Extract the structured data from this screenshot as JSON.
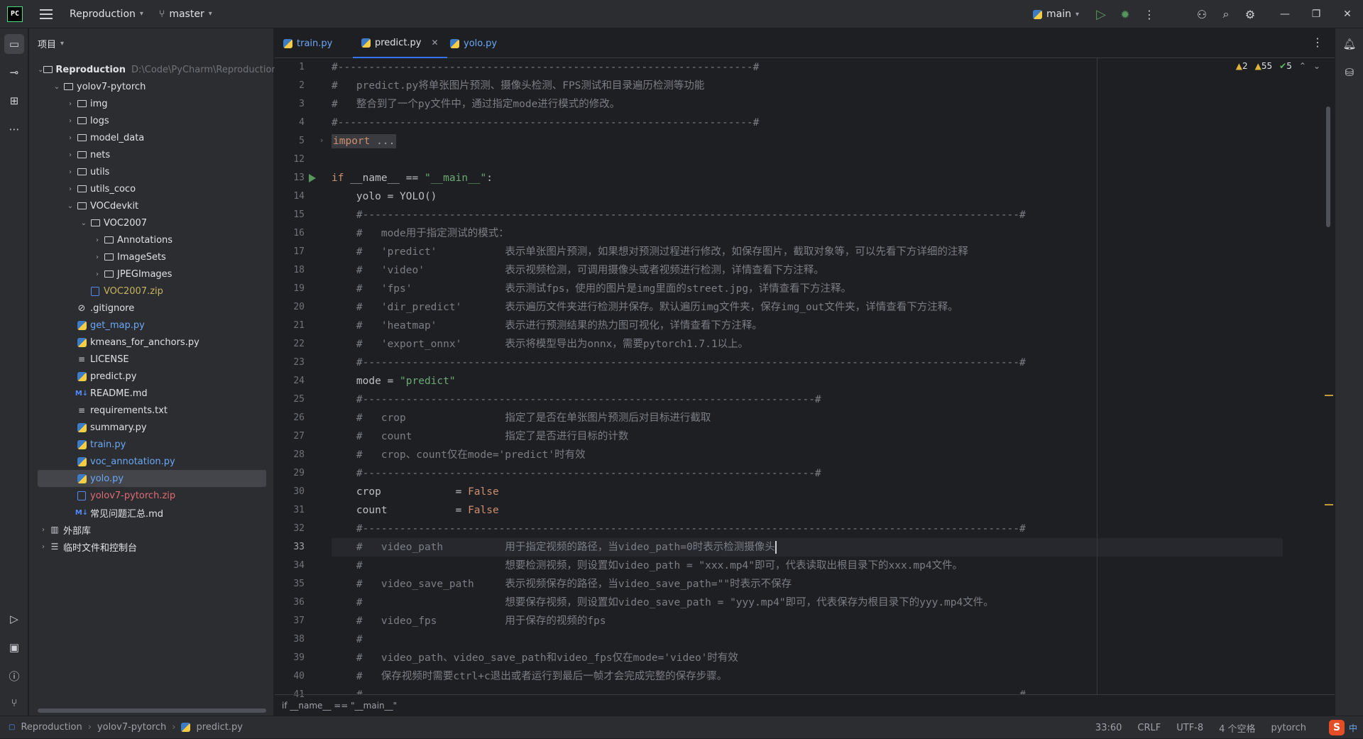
{
  "titlebar": {
    "logo": "PC",
    "project": "Reproduction",
    "branch": "master",
    "run_config": "main"
  },
  "project_panel": {
    "header": "项目",
    "tree": [
      {
        "depth": 0,
        "label": "Reproduction",
        "path": "D:\\Code\\PyCharm\\Reproduction",
        "type": "folder",
        "open": true,
        "bold": true
      },
      {
        "depth": 1,
        "label": "yolov7-pytorch",
        "type": "folder",
        "open": true
      },
      {
        "depth": 2,
        "label": "img",
        "type": "folder",
        "open": false
      },
      {
        "depth": 2,
        "label": "logs",
        "type": "folder",
        "open": false
      },
      {
        "depth": 2,
        "label": "model_data",
        "type": "folder",
        "open": false
      },
      {
        "depth": 2,
        "label": "nets",
        "type": "folder",
        "open": false
      },
      {
        "depth": 2,
        "label": "utils",
        "type": "folder",
        "open": false
      },
      {
        "depth": 2,
        "label": "utils_coco",
        "type": "folder",
        "open": false
      },
      {
        "depth": 2,
        "label": "VOCdevkit",
        "type": "folder",
        "open": true
      },
      {
        "depth": 3,
        "label": "VOC2007",
        "type": "folder",
        "open": true
      },
      {
        "depth": 4,
        "label": "Annotations",
        "type": "folder",
        "open": false
      },
      {
        "depth": 4,
        "label": "ImageSets",
        "type": "folder",
        "open": false
      },
      {
        "depth": 4,
        "label": "JPEGImages",
        "type": "folder",
        "open": false
      },
      {
        "depth": 3,
        "label": "VOC2007.zip",
        "type": "zip",
        "color": "yellow"
      },
      {
        "depth": 2,
        "label": ".gitignore",
        "type": "git"
      },
      {
        "depth": 2,
        "label": "get_map.py",
        "type": "py",
        "color": "blue"
      },
      {
        "depth": 2,
        "label": "kmeans_for_anchors.py",
        "type": "py"
      },
      {
        "depth": 2,
        "label": "LICENSE",
        "type": "txt"
      },
      {
        "depth": 2,
        "label": "predict.py",
        "type": "py"
      },
      {
        "depth": 2,
        "label": "README.md",
        "type": "md"
      },
      {
        "depth": 2,
        "label": "requirements.txt",
        "type": "txt"
      },
      {
        "depth": 2,
        "label": "summary.py",
        "type": "py"
      },
      {
        "depth": 2,
        "label": "train.py",
        "type": "py",
        "color": "blue"
      },
      {
        "depth": 2,
        "label": "voc_annotation.py",
        "type": "py",
        "color": "blue"
      },
      {
        "depth": 2,
        "label": "yolo.py",
        "type": "py",
        "color": "blue",
        "selected": true
      },
      {
        "depth": 2,
        "label": "yolov7-pytorch.zip",
        "type": "zip",
        "color": "red"
      },
      {
        "depth": 2,
        "label": "常见问题汇总.md",
        "type": "md"
      },
      {
        "depth": 0,
        "label": "外部库",
        "type": "lib",
        "open": false
      },
      {
        "depth": 0,
        "label": "临时文件和控制台",
        "type": "scratch",
        "open": false
      }
    ]
  },
  "tabs": [
    {
      "label": "train.py",
      "active": false,
      "color": "#6aa8f7"
    },
    {
      "label": "predict.py",
      "active": true
    },
    {
      "label": "yolo.py",
      "active": false,
      "color": "#6aa8f7"
    }
  ],
  "inspections": {
    "warn1": "2",
    "warn2": "55",
    "ok": "5"
  },
  "code_lines": [
    {
      "n": "1",
      "html": "<span class='cmt'>#-------------------------------------------------------------------#</span>"
    },
    {
      "n": "2",
      "html": "<span class='cmt'>#   predict.py将单张图片预测、摄像头检测、FPS测试和目录遍历检测等功能</span>"
    },
    {
      "n": "3",
      "html": "<span class='cmt'>#   整合到了一个py文件中，通过指定mode进行模式的修改。</span>"
    },
    {
      "n": "4",
      "html": "<span class='cmt'>#-------------------------------------------------------------------#</span>"
    },
    {
      "n": "5",
      "html": "<span class='folded'><span class='kw'>import</span> ...</span>",
      "fold": true
    },
    {
      "n": "12",
      "html": ""
    },
    {
      "n": "13",
      "html": "<span class='kw'>if</span> __name__ == <span class='str'>\"__main__\"</span>:",
      "run": true
    },
    {
      "n": "14",
      "html": "    yolo = YOLO()"
    },
    {
      "n": "15",
      "html": "    <span class='cmt'>#----------------------------------------------------------------------------------------------------------#</span>"
    },
    {
      "n": "16",
      "html": "    <span class='cmt'>#   mode用于指定测试的模式：</span>"
    },
    {
      "n": "17",
      "html": "    <span class='cmt'>#   'predict'           表示单张图片预测，如果想对预测过程进行修改，如保存图片，截取对象等，可以先看下方详细的注释</span>"
    },
    {
      "n": "18",
      "html": "    <span class='cmt'>#   'video'             表示视频检测，可调用摄像头或者视频进行检测，详情查看下方注释。</span>"
    },
    {
      "n": "19",
      "html": "    <span class='cmt'>#   'fps'               表示测试fps，使用的图片是img里面的street.jpg，详情查看下方注释。</span>"
    },
    {
      "n": "20",
      "html": "    <span class='cmt'>#   'dir_predict'       表示遍历文件夹进行检测并保存。默认遍历img文件夹，保存img_out文件夹，详情查看下方注释。</span>"
    },
    {
      "n": "21",
      "html": "    <span class='cmt'>#   'heatmap'           表示进行预测结果的热力图可视化，详情查看下方注释。</span>"
    },
    {
      "n": "22",
      "html": "    <span class='cmt'>#   'export_onnx'       表示将模型导出为onnx，需要pytorch1.7.1以上。</span>"
    },
    {
      "n": "23",
      "html": "    <span class='cmt'>#----------------------------------------------------------------------------------------------------------#</span>"
    },
    {
      "n": "24",
      "html": "    mode = <span class='str'>\"predict\"</span>"
    },
    {
      "n": "25",
      "html": "    <span class='cmt'>#-------------------------------------------------------------------------#</span>"
    },
    {
      "n": "26",
      "html": "    <span class='cmt'>#   crop                指定了是否在单张图片预测后对目标进行截取</span>"
    },
    {
      "n": "27",
      "html": "    <span class='cmt'>#   count               指定了是否进行目标的计数</span>"
    },
    {
      "n": "28",
      "html": "    <span class='cmt'>#   crop、count仅在mode='predict'时有效</span>"
    },
    {
      "n": "29",
      "html": "    <span class='cmt'>#-------------------------------------------------------------------------#</span>"
    },
    {
      "n": "30",
      "html": "    crop            = <span class='kw'>False</span>"
    },
    {
      "n": "31",
      "html": "    count           = <span class='kw'>False</span>"
    },
    {
      "n": "32",
      "html": "    <span class='cmt'>#----------------------------------------------------------------------------------------------------------#</span>"
    },
    {
      "n": "33",
      "html": "    <span class='cmt'>#   video_path          用于指定视频的路径，当video_path=0时表示检测摄像头</span><span class='caret-cursor'></span>",
      "current": true
    },
    {
      "n": "34",
      "html": "    <span class='cmt'>#                       想要检测视频，则设置如video_path = \"xxx.mp4\"即可，代表读取出根目录下的xxx.mp4文件。</span>"
    },
    {
      "n": "35",
      "html": "    <span class='cmt'>#   video_save_path     表示视频保存的路径，当video_save_path=\"\"时表示不保存</span>"
    },
    {
      "n": "36",
      "html": "    <span class='cmt'>#                       想要保存视频，则设置如video_save_path = \"yyy.mp4\"即可，代表保存为根目录下的yyy.mp4文件。</span>"
    },
    {
      "n": "37",
      "html": "    <span class='cmt'>#   video_fps           用于保存的视频的fps</span>"
    },
    {
      "n": "38",
      "html": "    <span class='cmt'>#</span>"
    },
    {
      "n": "39",
      "html": "    <span class='cmt'>#   video_path、video_save_path和video_fps仅在mode='video'时有效</span>"
    },
    {
      "n": "40",
      "html": "    <span class='cmt'>#   保存视频时需要ctrl+c退出或者运行到最后一帧才会完成完整的保存步骤。</span>"
    },
    {
      "n": "41",
      "html": "    <span class='cmt'>#----------------------------------------------------------------------------------------------------------#</span>"
    }
  ],
  "editor_breadcrumb": "if __name__ == \"__main__\"",
  "statusbar": {
    "crumbs": [
      "Reproduction",
      "yolov7-pytorch",
      "predict.py"
    ],
    "position": "33:60",
    "line_sep": "CRLF",
    "encoding": "UTF-8",
    "indent": "4 个空格",
    "interpreter": "pytorch",
    "ime_logo": "S",
    "ime_mode": "中"
  }
}
